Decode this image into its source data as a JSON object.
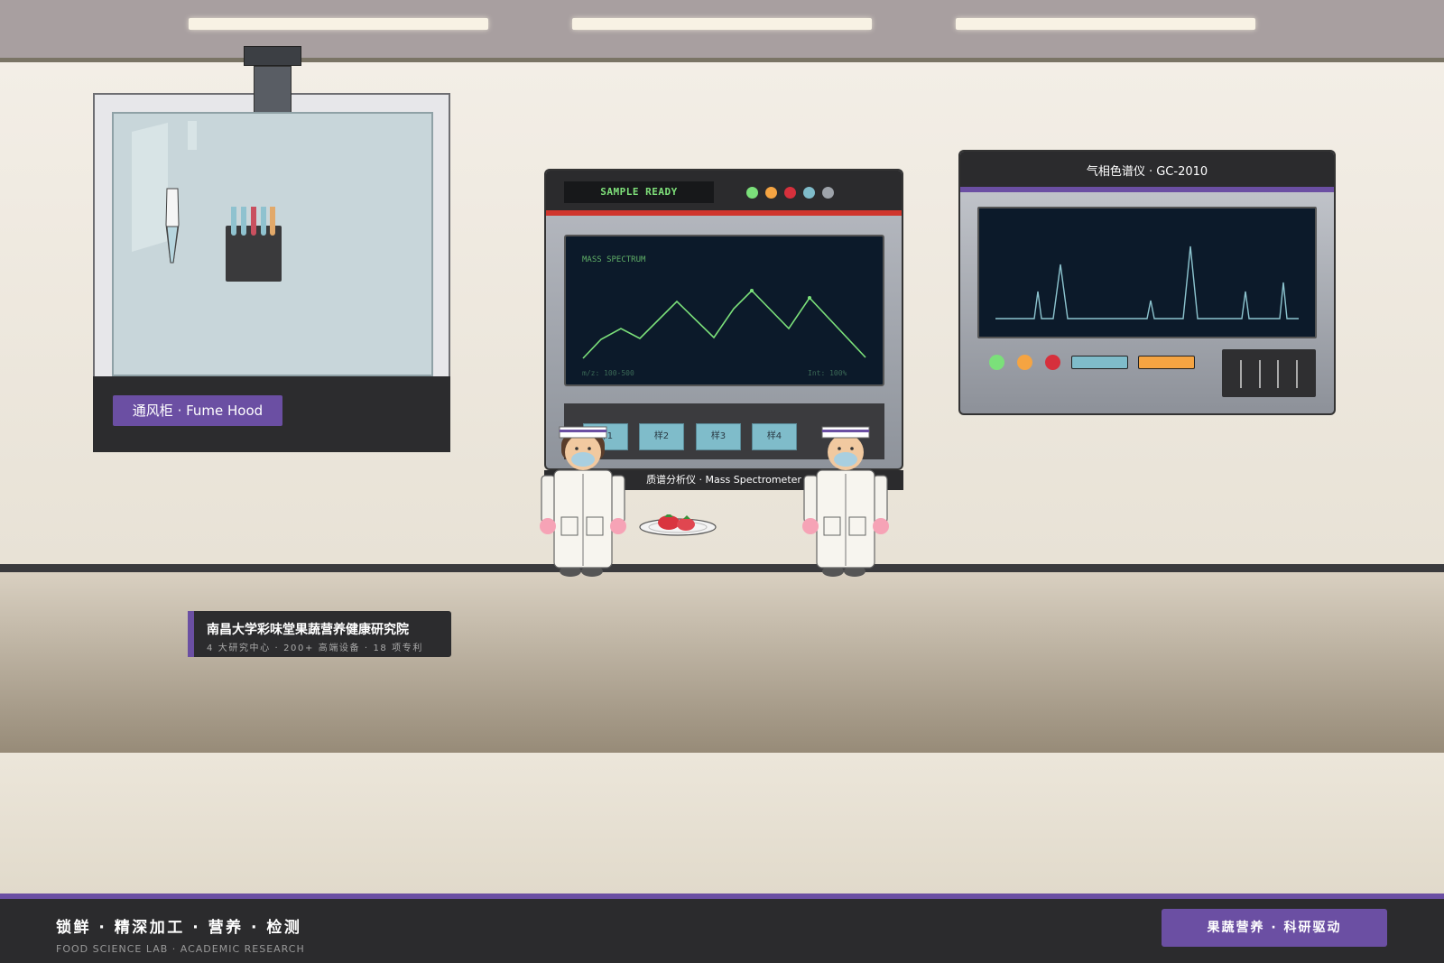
{
  "fume_hood": {
    "label": "通风柜 · Fume Hood"
  },
  "mass_spectrometer": {
    "status": "SAMPLE READY",
    "screen_title": "MASS SPECTRUM",
    "mz_range": "m/z: 100-500",
    "intensity": "Int: 100%",
    "samples": [
      "样1",
      "样2",
      "样3",
      "样4"
    ],
    "label": "质谱分析仪 · Mass Spectrometer",
    "leds": [
      "#7be07a",
      "#f5a442",
      "#d6303c",
      "#7fbcca",
      "#9ea3aa"
    ]
  },
  "gas_chromatograph": {
    "label": "气相色谱仪 · GC-2010",
    "leds": [
      "#7be07a",
      "#f5a442",
      "#d6303c"
    ]
  },
  "sign": {
    "title": "南昌大学彩味堂果蔬营养健康研究院",
    "subtitle": "4 大研究中心 · 200+ 高端设备 · 18 项专利"
  },
  "footer": {
    "main": "锁鲜 · 精深加工 · 营养 · 检测",
    "sub": "FOOD SCIENCE LAB · ACADEMIC RESEARCH",
    "button": "果蔬营养 · 科研驱动"
  },
  "colors": {
    "accent": "#6b4fa3",
    "dark": "#2b2b2d",
    "screen": "#0c1a2a",
    "trace_green": "#7be07a",
    "trace_blue": "#8cc4cf"
  }
}
